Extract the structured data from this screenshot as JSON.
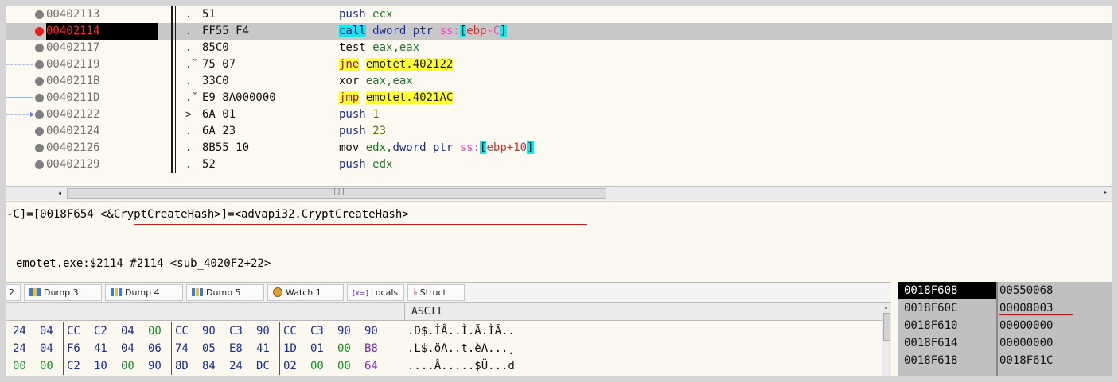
{
  "disasm": {
    "rows": [
      {
        "addr": "00402113",
        "mark": ".",
        "bytes": "51"
      },
      {
        "addr": "00402114",
        "mark": ".",
        "bytes": "FF55 F4"
      },
      {
        "addr": "00402117",
        "mark": ".",
        "bytes": "85C0"
      },
      {
        "addr": "00402119",
        "mark": ".ˇ",
        "bytes": "75 07"
      },
      {
        "addr": "0040211B",
        "mark": ".",
        "bytes": "33C0"
      },
      {
        "addr": "0040211D",
        "mark": ".ˇ",
        "bytes": "E9 8A000000"
      },
      {
        "addr": "00402122",
        "mark": ">",
        "bytes": "6A 01"
      },
      {
        "addr": "00402124",
        "mark": ".",
        "bytes": "6A 23"
      },
      {
        "addr": "00402126",
        "mark": ".",
        "bytes": "8B55 10"
      },
      {
        "addr": "00402129",
        "mark": ".",
        "bytes": "52"
      }
    ],
    "ins": {
      "r0": {
        "mn": "push",
        "op": "ecx"
      },
      "r1": {
        "mn": "call",
        "a": "dword ptr ",
        "ss": "ss:",
        "br1": "[",
        "reg": "ebp",
        "neg": "-C",
        "br2": "]"
      },
      "r2": {
        "mn": "test",
        "op": "eax,eax"
      },
      "r3": {
        "mn": "jne",
        "lbl": "emotet.402122"
      },
      "r4": {
        "mn": "xor",
        "op": "eax,eax"
      },
      "r5": {
        "mn": "jmp",
        "lbl": "emotet.4021AC"
      },
      "r6": {
        "mn": "push",
        "op": "1"
      },
      "r7": {
        "mn": "push",
        "op": "23"
      },
      "r8": {
        "mn": "mov",
        "a": "edx,",
        "b": "dword ptr ",
        "ss": "ss:",
        "br1": "[",
        "reg": "ebp",
        "plus": "+10",
        "br2": "]"
      },
      "r9": {
        "mn": "push",
        "op": "edx"
      }
    }
  },
  "info": {
    "line1": "-C]=[0018F654 <&CryptCreateHash>]=<advapi32.CryptCreateHash>",
    "line2": "emotet.exe:$2114 #2114 <sub_4020F2+22>"
  },
  "tabs": {
    "first": "2",
    "items": [
      "Dump 3",
      "Dump 4",
      "Dump 5",
      "Watch 1",
      "Locals",
      "Struct"
    ],
    "locals_prefix": "[x=]"
  },
  "dump": {
    "ascii_header": "ASCII",
    "rows": [
      {
        "hex": [
          "24",
          "04",
          "CC",
          "C2",
          "04",
          "00",
          "CC",
          "90",
          "C3",
          "90",
          "CC",
          "C3",
          "90",
          "90"
        ],
        "ascii": ".D$.ÌÂ..Ì.Ã.ÌÃ.."
      },
      {
        "hex": [
          "24",
          "04",
          "F6",
          "41",
          "04",
          "06",
          "74",
          "05",
          "E8",
          "41",
          "1D",
          "01",
          "00",
          "B8"
        ],
        "ascii": ".L$.öA..t.èA...¸"
      },
      {
        "hex": [
          "00",
          "00",
          "C2",
          "10",
          "00",
          "90",
          "8D",
          "84",
          "24",
          "DC",
          "02",
          "00",
          "00",
          "64"
        ],
        "ascii": "....Â.....$Ü...d"
      }
    ]
  },
  "stack": {
    "rows": [
      {
        "addr": "0018F608",
        "val": "00550068"
      },
      {
        "addr": "0018F60C",
        "val": "00008003"
      },
      {
        "addr": "0018F610",
        "val": "00000000"
      },
      {
        "addr": "0018F614",
        "val": "00000000"
      },
      {
        "addr": "0018F618",
        "val": "0018F61C"
      }
    ]
  },
  "colors": {
    "breakpoint": "#e42020",
    "call_highlight": "#19e4e8",
    "jump_highlight": "#ffff38",
    "selection_row": "#c8c8c8",
    "stack_bg": "#c0c0c0"
  }
}
